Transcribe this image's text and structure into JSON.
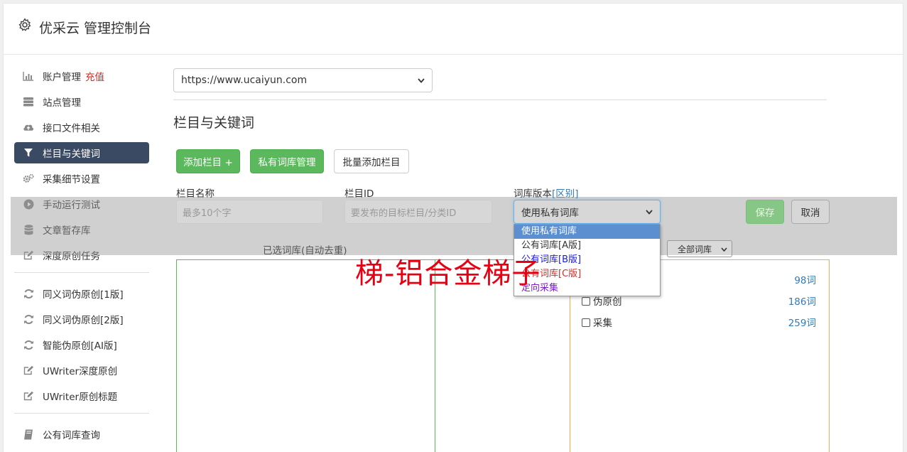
{
  "app": {
    "title": "优采云 管理控制台"
  },
  "sidebar": {
    "items": [
      {
        "label": "账户管理",
        "icon": "bar-chart-icon",
        "extra": "充值"
      },
      {
        "label": "站点管理",
        "icon": "server-icon"
      },
      {
        "label": "接口文件相关",
        "icon": "cloud-upload-icon"
      },
      {
        "label": "栏目与关键词",
        "icon": "filter-icon",
        "active": true
      },
      {
        "label": "采集细节设置",
        "icon": "cogs-icon"
      },
      {
        "label": "手动运行测试",
        "icon": "play-circle-icon"
      },
      {
        "label": "文章暂存库",
        "icon": "database-icon"
      },
      {
        "label": "深度原创任务",
        "icon": "edit-icon"
      }
    ],
    "items2": [
      {
        "label": "同义词伪原创[1版]",
        "icon": "refresh-icon"
      },
      {
        "label": "同义词伪原创[2版]",
        "icon": "refresh-icon"
      },
      {
        "label": "智能伪原创[AI版]",
        "icon": "refresh-icon"
      },
      {
        "label": "UWriter深度原创",
        "icon": "edit-icon"
      },
      {
        "label": "UWriter原创标题",
        "icon": "edit-icon"
      }
    ],
    "items3": [
      {
        "label": "公有词库查询",
        "icon": "book-icon"
      }
    ]
  },
  "main": {
    "site_select": "https://www.ucaiyun.com",
    "section_title": "栏目与关键词",
    "buttons": {
      "add_column": "添加栏目 +",
      "private_lib": "私有词库管理",
      "batch_add": "批量添加栏目"
    },
    "form": {
      "name_label": "栏目名称",
      "name_placeholder": "最多10个字",
      "id_label": "栏目ID",
      "id_placeholder": "要发布的目标栏目/分类ID",
      "lib_label": "词库版本",
      "lib_diff_link": "[区别]",
      "lib_selected": "使用私有词库",
      "lib_options": [
        "使用私有词库",
        "公有词库[A版]",
        "公有词库[B版]",
        "公有词库[C版]",
        "定向采集"
      ],
      "save": "保存",
      "cancel": "取消"
    },
    "selected_lib_label": "已选词库(自动去重)",
    "lib_filter": "全部词库",
    "libraries": [
      {
        "name": "",
        "count": "98词"
      },
      {
        "name": "伪原创",
        "count": "186词"
      },
      {
        "name": "采集",
        "count": "259词"
      }
    ]
  },
  "colors": {
    "active_nav": "#3b4a63",
    "green": "#5cb85c",
    "link": "#337ab7",
    "recharge": "#d9251d",
    "yellow_border": "#f0ad4e"
  },
  "watermark": "梯-铝合金梯子"
}
